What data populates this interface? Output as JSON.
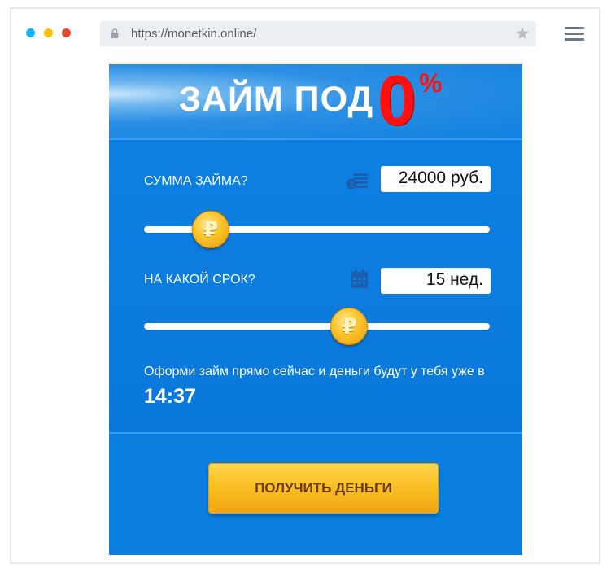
{
  "browser": {
    "url": "https://monetkin.online/",
    "dot_colors": [
      "#1ab0f0",
      "#ffc107",
      "#e8492e"
    ]
  },
  "hero": {
    "headline": "ЗАЙМ ПОД",
    "rate": "0",
    "rate_unit": "%"
  },
  "loan_amount": {
    "label": "СУММА ЗАЙМА?",
    "value": "24000 руб.",
    "slider_fraction": 0.15,
    "icon": "coins-stack-icon"
  },
  "loan_term": {
    "label": "НА КАКОЙ СРОК?",
    "value": "15 нед.",
    "slider_fraction": 0.6,
    "icon": "calendar-icon"
  },
  "promo": {
    "text": "Оформи займ прямо сейчас и деньги будут у тебя уже в",
    "time": "14:37"
  },
  "cta": {
    "label": "ПОЛУЧИТЬ ДЕНЬГИ"
  },
  "coin_symbol": "₽"
}
